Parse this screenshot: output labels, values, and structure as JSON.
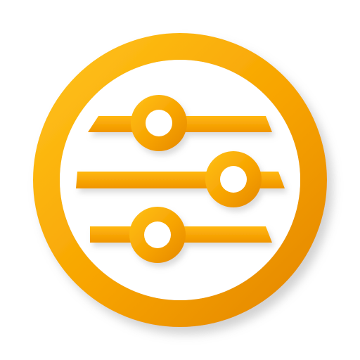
{
  "icon": {
    "name": "settings-sliders-icon",
    "description_type": "app-icon",
    "colors": {
      "background": "#ffffff",
      "gold_light": "#ffc21a",
      "gold_mid": "#f7a300",
      "gold_dark": "#e48700",
      "inner_fill": "#ffffff",
      "shadow": "#b9b9b9"
    },
    "sliders": [
      {
        "name": "top-slider",
        "knob_position": 0.33
      },
      {
        "name": "middle-slider",
        "knob_position": 0.79
      },
      {
        "name": "bottom-slider",
        "knob_position": 0.4
      }
    ]
  }
}
